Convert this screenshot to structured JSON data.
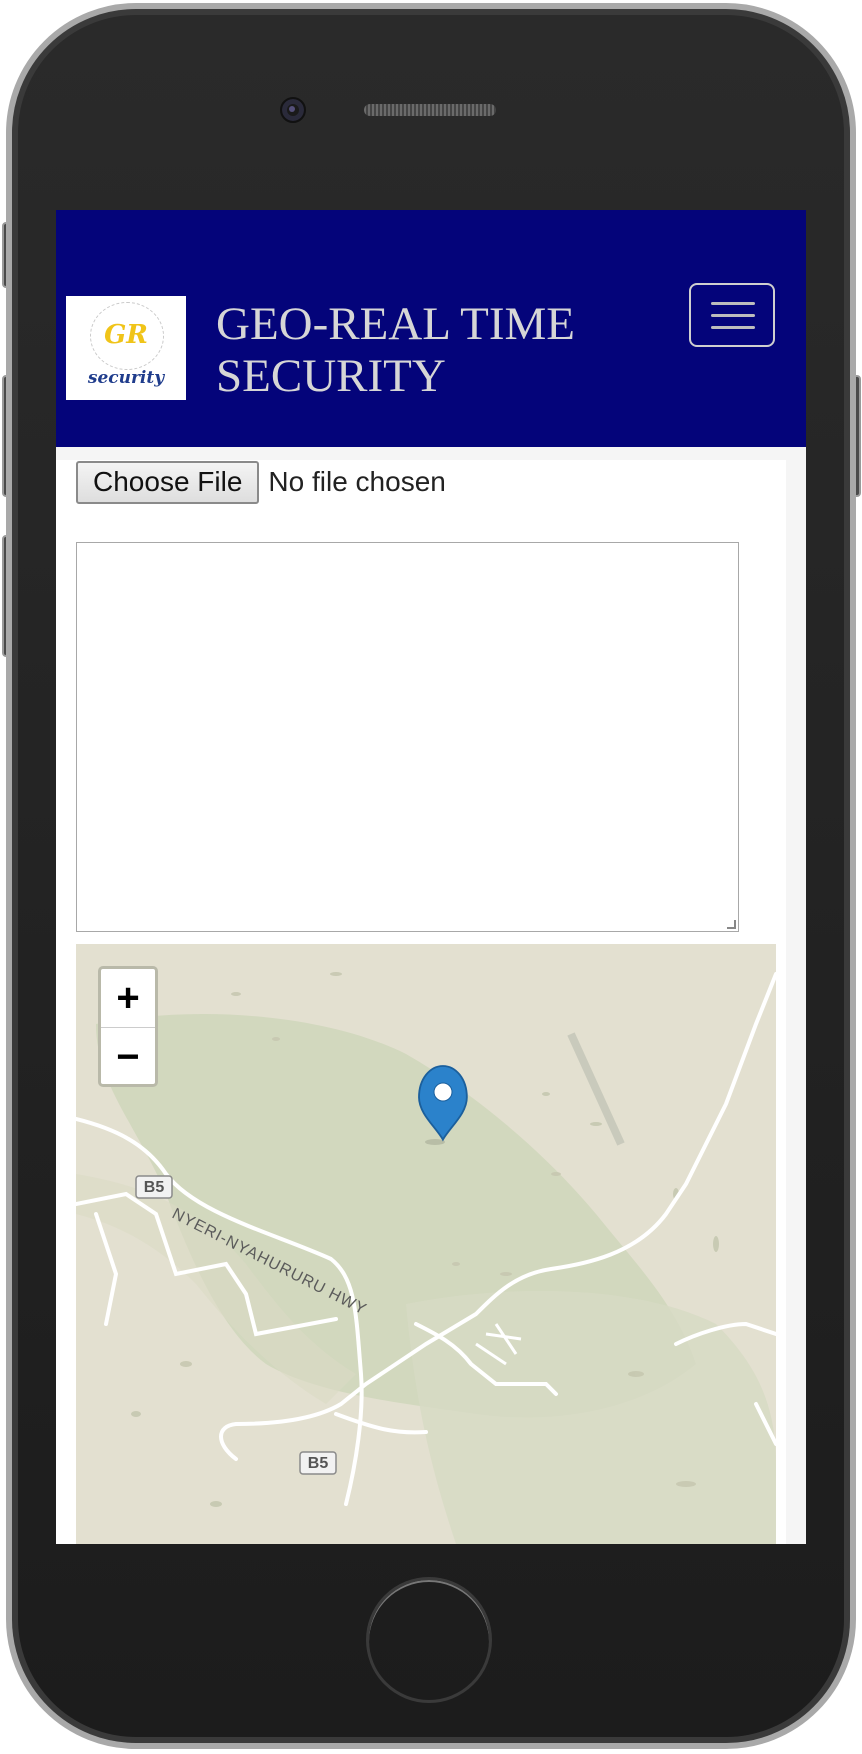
{
  "header": {
    "brand_line1": "GEO-REAL TIME",
    "brand_line2": "SECURITY",
    "logo_initials": "GR",
    "logo_word": "security",
    "colors": {
      "navbar": "#04047a",
      "brand_text": "#d6d6d6"
    }
  },
  "upload": {
    "button_label": "Choose File",
    "status": "No file chosen"
  },
  "map": {
    "zoom_in": "+",
    "zoom_out": "−",
    "road_name": "NYERI-NYAHURURU HWY",
    "shield_1": "B5",
    "shield_2": "B5",
    "marker_icon": "map-pin-icon"
  }
}
